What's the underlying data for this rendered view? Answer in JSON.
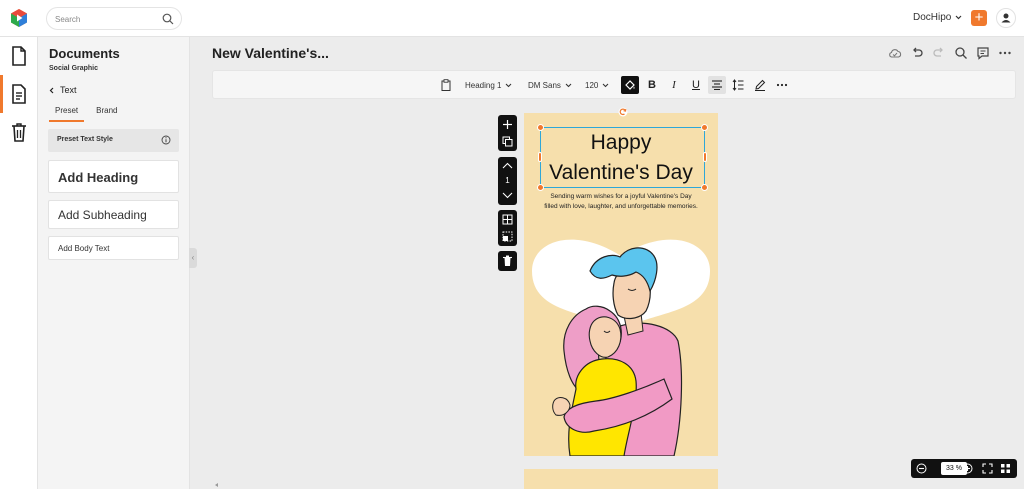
{
  "header": {
    "search_placeholder": "Search",
    "account_label": "DocHipo",
    "colors": {
      "accent": "#f0792d"
    }
  },
  "rail": {
    "items": [
      {
        "name": "documents",
        "icon": "document-icon"
      },
      {
        "name": "text",
        "icon": "text-doc-icon",
        "active": true
      },
      {
        "name": "trash",
        "icon": "trash-icon"
      }
    ]
  },
  "panel": {
    "title": "Documents",
    "subtitle": "Social Graphic",
    "back_label": "Text",
    "tabs": [
      {
        "label": "Preset",
        "active": true
      },
      {
        "label": "Brand"
      }
    ],
    "preset_style_label": "Preset Text Style",
    "add_heading": "Add Heading",
    "add_subheading": "Add Subheading",
    "add_body": "Add Body Text"
  },
  "document": {
    "title": "New Valentine's..."
  },
  "toolbar": {
    "text_style": "Heading 1",
    "font": "DM Sans",
    "size": "120",
    "bold": "B",
    "italic": "I",
    "underline": "U"
  },
  "canvas": {
    "page_number": "1",
    "heading_line1": "Happy",
    "heading_line2": "Valentine's Day",
    "wish_text": "Sending warm wishes for a joyful Valentine's Day filled with love, laughter, and unforgettable memories.",
    "colors": {
      "page_bg": "#f6dfac",
      "selection": "#2fa7d8"
    }
  },
  "zoom": {
    "value": "33",
    "unit": "%"
  }
}
